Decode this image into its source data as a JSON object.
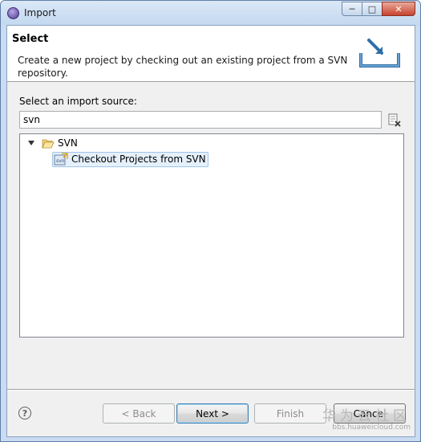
{
  "window": {
    "title": "Import",
    "controls": {
      "minimize": "─",
      "maximize": "□",
      "close": "✕"
    }
  },
  "banner": {
    "title": "Select",
    "description": "Create a new project by checking out an existing project from a SVN repository."
  },
  "source": {
    "label": "Select an import source:",
    "filter_value": "svn"
  },
  "tree": {
    "category": "SVN",
    "selected_item": "Checkout Projects from SVN"
  },
  "buttons": {
    "help": "?",
    "back": "< Back",
    "next": "Next >",
    "finish": "Finish",
    "cancel": "Cancel"
  },
  "watermark": {
    "text": "华为云社区",
    "url": "bbs.huaweicloud.com"
  }
}
